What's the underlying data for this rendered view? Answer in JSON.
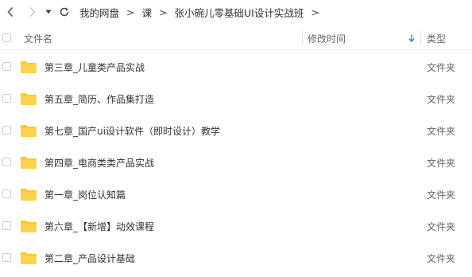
{
  "nav": {
    "back_icon": "chevron-left-icon",
    "forward_icon": "chevron-right-icon",
    "dropdown_icon": "caret-down-icon",
    "refresh_icon": "refresh-icon"
  },
  "breadcrumb": {
    "separator": ">",
    "items": [
      "我的网盘",
      "课",
      "张小碗儿零基础UI设计实战班"
    ]
  },
  "columns": {
    "name": "文件名",
    "modified": "修改时间",
    "type": "类型",
    "sort_icon": "arrow-down-icon",
    "sort_color": "#1a8cff"
  },
  "folder_color": "#ffc933",
  "files": [
    {
      "name": "第三章_儿童类产品实战",
      "type": "文件夹"
    },
    {
      "name": "第五章_简历、作品集打造",
      "type": "文件夹"
    },
    {
      "name": "第七章_国产ui设计软件（即时设计）教学",
      "type": "文件夹"
    },
    {
      "name": "第四章_电商类类产品实战",
      "type": "文件夹"
    },
    {
      "name": "第一章_岗位认知篇",
      "type": "文件夹"
    },
    {
      "name": "第六章_【新增】动效课程",
      "type": "文件夹"
    },
    {
      "name": "第二章_产品设计基础",
      "type": "文件夹"
    }
  ]
}
